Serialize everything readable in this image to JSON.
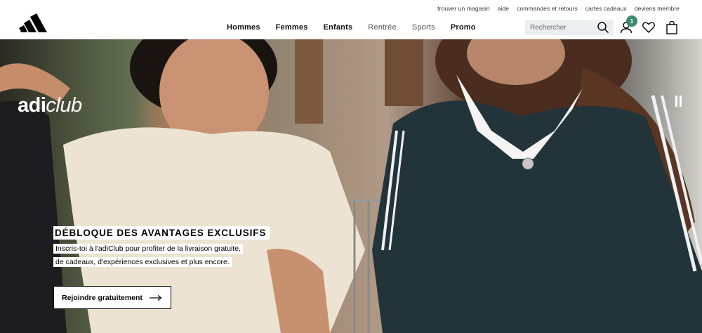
{
  "header": {
    "utility_links": [
      "trouver un magasin",
      "aide",
      "commandes et retours",
      "cartes cadeaux",
      "deviens membre"
    ],
    "nav": [
      {
        "label": "Hommes",
        "style": "bold"
      },
      {
        "label": "Femmes",
        "style": "bold"
      },
      {
        "label": "Enfants",
        "style": "bold"
      },
      {
        "label": "Rentrée",
        "style": "light"
      },
      {
        "label": "Sports",
        "style": "light"
      },
      {
        "label": "Promo",
        "style": "bold"
      }
    ],
    "search_placeholder": "Rechercher",
    "account_badge": "1",
    "icons": [
      "search-icon",
      "account-icon",
      "wishlist-heart-icon",
      "shopping-bag-icon"
    ]
  },
  "hero": {
    "brand_wordmark_bold": "adi",
    "brand_wordmark_italic": "club",
    "headline": "DÉBLOQUE DES AVANTAGES EXCLUSIFS",
    "body": "Inscris-toi à l'adiClub pour profiter de la livraison gratuite, de cadeaux, d'expériences exclusives et plus encore.",
    "cta_label": "Rejoindre gratuitement",
    "pause_icon": "pause-icon"
  },
  "colors": {
    "badge": "#3a8a6e",
    "text": "#000000",
    "search_bg": "#eceff1"
  }
}
